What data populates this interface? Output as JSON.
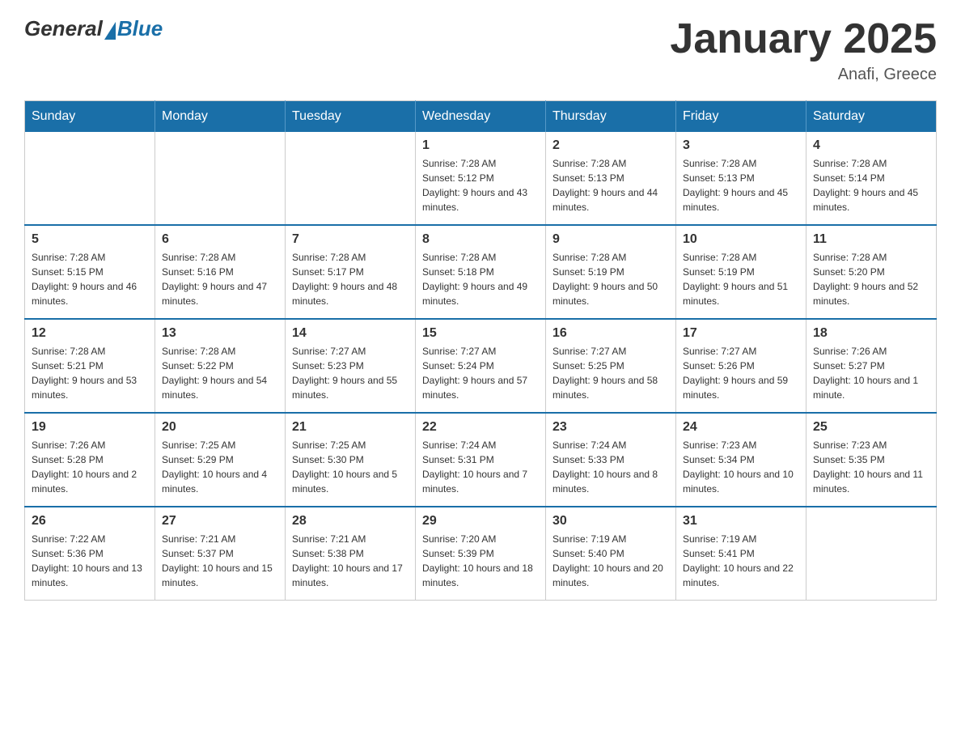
{
  "header": {
    "logo_general": "General",
    "logo_blue": "Blue",
    "month_title": "January 2025",
    "location": "Anafi, Greece"
  },
  "days_of_week": [
    "Sunday",
    "Monday",
    "Tuesday",
    "Wednesday",
    "Thursday",
    "Friday",
    "Saturday"
  ],
  "weeks": [
    [
      {
        "day": "",
        "sunrise": "",
        "sunset": "",
        "daylight": ""
      },
      {
        "day": "",
        "sunrise": "",
        "sunset": "",
        "daylight": ""
      },
      {
        "day": "",
        "sunrise": "",
        "sunset": "",
        "daylight": ""
      },
      {
        "day": "1",
        "sunrise": "Sunrise: 7:28 AM",
        "sunset": "Sunset: 5:12 PM",
        "daylight": "Daylight: 9 hours and 43 minutes."
      },
      {
        "day": "2",
        "sunrise": "Sunrise: 7:28 AM",
        "sunset": "Sunset: 5:13 PM",
        "daylight": "Daylight: 9 hours and 44 minutes."
      },
      {
        "day": "3",
        "sunrise": "Sunrise: 7:28 AM",
        "sunset": "Sunset: 5:13 PM",
        "daylight": "Daylight: 9 hours and 45 minutes."
      },
      {
        "day": "4",
        "sunrise": "Sunrise: 7:28 AM",
        "sunset": "Sunset: 5:14 PM",
        "daylight": "Daylight: 9 hours and 45 minutes."
      }
    ],
    [
      {
        "day": "5",
        "sunrise": "Sunrise: 7:28 AM",
        "sunset": "Sunset: 5:15 PM",
        "daylight": "Daylight: 9 hours and 46 minutes."
      },
      {
        "day": "6",
        "sunrise": "Sunrise: 7:28 AM",
        "sunset": "Sunset: 5:16 PM",
        "daylight": "Daylight: 9 hours and 47 minutes."
      },
      {
        "day": "7",
        "sunrise": "Sunrise: 7:28 AM",
        "sunset": "Sunset: 5:17 PM",
        "daylight": "Daylight: 9 hours and 48 minutes."
      },
      {
        "day": "8",
        "sunrise": "Sunrise: 7:28 AM",
        "sunset": "Sunset: 5:18 PM",
        "daylight": "Daylight: 9 hours and 49 minutes."
      },
      {
        "day": "9",
        "sunrise": "Sunrise: 7:28 AM",
        "sunset": "Sunset: 5:19 PM",
        "daylight": "Daylight: 9 hours and 50 minutes."
      },
      {
        "day": "10",
        "sunrise": "Sunrise: 7:28 AM",
        "sunset": "Sunset: 5:19 PM",
        "daylight": "Daylight: 9 hours and 51 minutes."
      },
      {
        "day": "11",
        "sunrise": "Sunrise: 7:28 AM",
        "sunset": "Sunset: 5:20 PM",
        "daylight": "Daylight: 9 hours and 52 minutes."
      }
    ],
    [
      {
        "day": "12",
        "sunrise": "Sunrise: 7:28 AM",
        "sunset": "Sunset: 5:21 PM",
        "daylight": "Daylight: 9 hours and 53 minutes."
      },
      {
        "day": "13",
        "sunrise": "Sunrise: 7:28 AM",
        "sunset": "Sunset: 5:22 PM",
        "daylight": "Daylight: 9 hours and 54 minutes."
      },
      {
        "day": "14",
        "sunrise": "Sunrise: 7:27 AM",
        "sunset": "Sunset: 5:23 PM",
        "daylight": "Daylight: 9 hours and 55 minutes."
      },
      {
        "day": "15",
        "sunrise": "Sunrise: 7:27 AM",
        "sunset": "Sunset: 5:24 PM",
        "daylight": "Daylight: 9 hours and 57 minutes."
      },
      {
        "day": "16",
        "sunrise": "Sunrise: 7:27 AM",
        "sunset": "Sunset: 5:25 PM",
        "daylight": "Daylight: 9 hours and 58 minutes."
      },
      {
        "day": "17",
        "sunrise": "Sunrise: 7:27 AM",
        "sunset": "Sunset: 5:26 PM",
        "daylight": "Daylight: 9 hours and 59 minutes."
      },
      {
        "day": "18",
        "sunrise": "Sunrise: 7:26 AM",
        "sunset": "Sunset: 5:27 PM",
        "daylight": "Daylight: 10 hours and 1 minute."
      }
    ],
    [
      {
        "day": "19",
        "sunrise": "Sunrise: 7:26 AM",
        "sunset": "Sunset: 5:28 PM",
        "daylight": "Daylight: 10 hours and 2 minutes."
      },
      {
        "day": "20",
        "sunrise": "Sunrise: 7:25 AM",
        "sunset": "Sunset: 5:29 PM",
        "daylight": "Daylight: 10 hours and 4 minutes."
      },
      {
        "day": "21",
        "sunrise": "Sunrise: 7:25 AM",
        "sunset": "Sunset: 5:30 PM",
        "daylight": "Daylight: 10 hours and 5 minutes."
      },
      {
        "day": "22",
        "sunrise": "Sunrise: 7:24 AM",
        "sunset": "Sunset: 5:31 PM",
        "daylight": "Daylight: 10 hours and 7 minutes."
      },
      {
        "day": "23",
        "sunrise": "Sunrise: 7:24 AM",
        "sunset": "Sunset: 5:33 PM",
        "daylight": "Daylight: 10 hours and 8 minutes."
      },
      {
        "day": "24",
        "sunrise": "Sunrise: 7:23 AM",
        "sunset": "Sunset: 5:34 PM",
        "daylight": "Daylight: 10 hours and 10 minutes."
      },
      {
        "day": "25",
        "sunrise": "Sunrise: 7:23 AM",
        "sunset": "Sunset: 5:35 PM",
        "daylight": "Daylight: 10 hours and 11 minutes."
      }
    ],
    [
      {
        "day": "26",
        "sunrise": "Sunrise: 7:22 AM",
        "sunset": "Sunset: 5:36 PM",
        "daylight": "Daylight: 10 hours and 13 minutes."
      },
      {
        "day": "27",
        "sunrise": "Sunrise: 7:21 AM",
        "sunset": "Sunset: 5:37 PM",
        "daylight": "Daylight: 10 hours and 15 minutes."
      },
      {
        "day": "28",
        "sunrise": "Sunrise: 7:21 AM",
        "sunset": "Sunset: 5:38 PM",
        "daylight": "Daylight: 10 hours and 17 minutes."
      },
      {
        "day": "29",
        "sunrise": "Sunrise: 7:20 AM",
        "sunset": "Sunset: 5:39 PM",
        "daylight": "Daylight: 10 hours and 18 minutes."
      },
      {
        "day": "30",
        "sunrise": "Sunrise: 7:19 AM",
        "sunset": "Sunset: 5:40 PM",
        "daylight": "Daylight: 10 hours and 20 minutes."
      },
      {
        "day": "31",
        "sunrise": "Sunrise: 7:19 AM",
        "sunset": "Sunset: 5:41 PM",
        "daylight": "Daylight: 10 hours and 22 minutes."
      },
      {
        "day": "",
        "sunrise": "",
        "sunset": "",
        "daylight": ""
      }
    ]
  ]
}
